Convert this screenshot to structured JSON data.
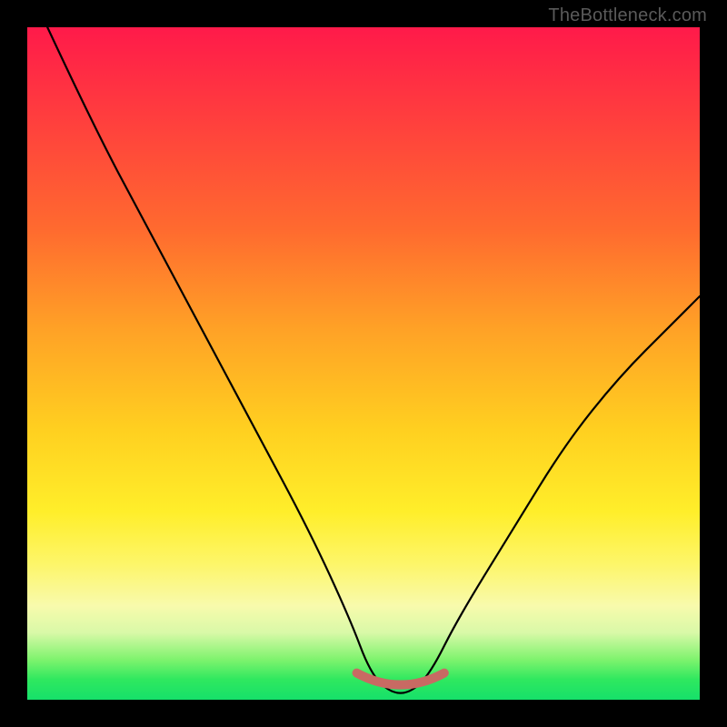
{
  "attribution": "TheBottleneck.com",
  "chart_data": {
    "type": "line",
    "title": "",
    "xlabel": "",
    "ylabel": "",
    "xlim": [
      0,
      100
    ],
    "ylim": [
      0,
      100
    ],
    "series": [
      {
        "name": "bottleneck-curve",
        "x": [
          3,
          10,
          18,
          26,
          34,
          42,
          48,
          51,
          54,
          57,
          60,
          64,
          72,
          80,
          88,
          96,
          100
        ],
        "y": [
          100,
          85,
          70,
          55,
          40,
          25,
          12,
          4,
          1,
          1,
          4,
          12,
          25,
          38,
          48,
          56,
          60
        ]
      }
    ],
    "annotations": [
      {
        "name": "trough-highlight",
        "x_range": [
          49,
          62
        ],
        "y": 1,
        "color": "#c86a63"
      }
    ],
    "background_gradient": {
      "orientation": "vertical",
      "stops": [
        {
          "pos": 0,
          "color": "#ff1a4a"
        },
        {
          "pos": 30,
          "color": "#ff6a2f"
        },
        {
          "pos": 60,
          "color": "#ffd020"
        },
        {
          "pos": 86,
          "color": "#f8faac"
        },
        {
          "pos": 100,
          "color": "#16e06a"
        }
      ]
    }
  }
}
